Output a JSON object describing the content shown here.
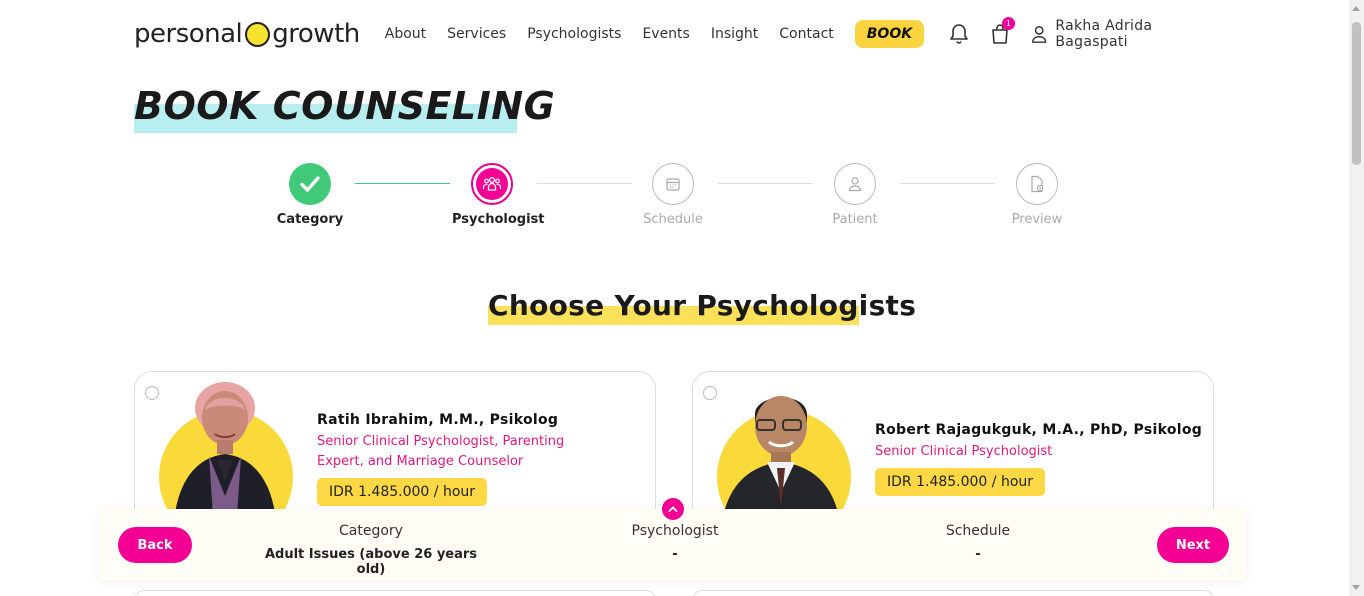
{
  "header": {
    "logo_left": "personal",
    "logo_right": "growth",
    "nav": [
      "About",
      "Services",
      "Psychologists",
      "Events",
      "Insight",
      "Contact"
    ],
    "book_label": "BOOK",
    "cart_count": "1",
    "user_name": "Rakha Adrida Bagaspati",
    "accent_color": "#fad33f",
    "brand_pink": "#f40095"
  },
  "page": {
    "title": "BOOK COUNSELING",
    "section_title": "Choose Your Psychologists"
  },
  "stepper": {
    "steps": [
      {
        "label": "Category",
        "state": "done",
        "icon": "check-icon"
      },
      {
        "label": "Psychologist",
        "state": "active",
        "icon": "people-icon"
      },
      {
        "label": "Schedule",
        "state": "todo",
        "icon": "calendar-icon"
      },
      {
        "label": "Patient",
        "state": "todo",
        "icon": "user-icon"
      },
      {
        "label": "Preview",
        "state": "todo",
        "icon": "document-icon"
      }
    ]
  },
  "psychologists": [
    {
      "name": "Ratih Ibrahim, M.M., Psikolog",
      "title": "Senior Clinical Psychologist, Parenting Expert, and Marriage Counselor",
      "price": "IDR 1.485.000 / hour"
    },
    {
      "name": "Robert Rajagukguk, M.A., PhD, Psikolog",
      "title": "Senior Clinical Psychologist",
      "price": "IDR 1.485.000 / hour"
    }
  ],
  "summary": {
    "back_label": "Back",
    "next_label": "Next",
    "category_label": "Category",
    "category_value": "Adult Issues (above 26 years old)",
    "psychologist_label": "Psychologist",
    "psychologist_value": "-",
    "schedule_label": "Schedule",
    "schedule_value": "-"
  }
}
